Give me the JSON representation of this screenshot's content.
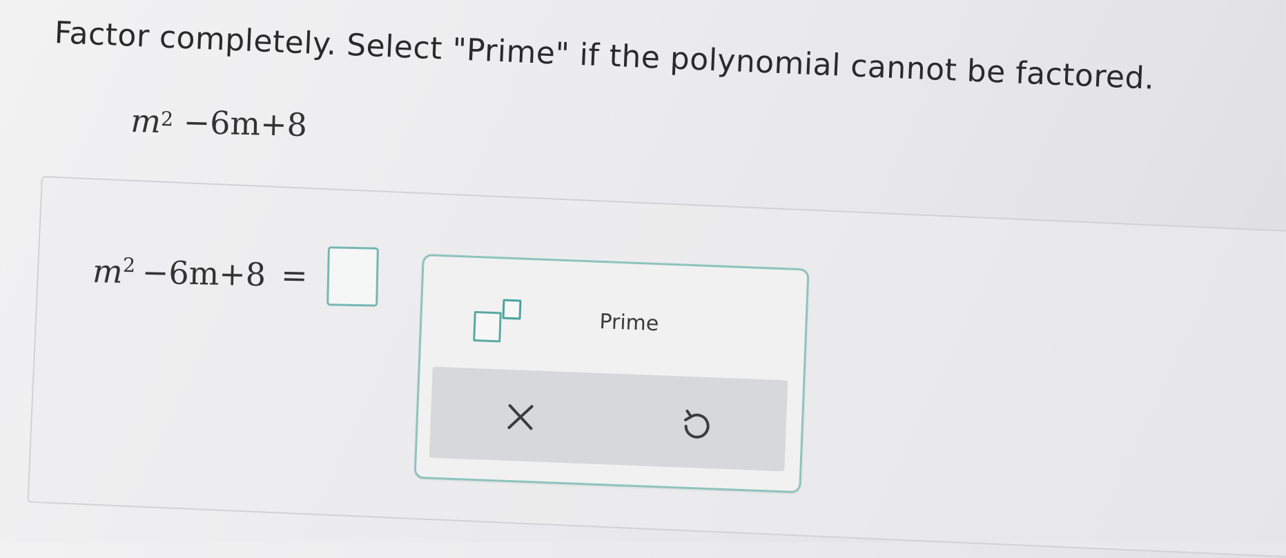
{
  "question": {
    "instruction": "Factor completely. Select \"Prime\" if the polynomial cannot be factored.",
    "expression": {
      "variable": "m",
      "exponent": "2",
      "rest": "−6m+8"
    }
  },
  "answer": {
    "lhs": {
      "variable": "m",
      "exponent": "2",
      "rest": "−6m+8",
      "equals": "="
    }
  },
  "keypad": {
    "prime_label": "Prime",
    "exponent_button": "superscript",
    "clear_icon": "x-icon",
    "undo_icon": "undo-icon"
  },
  "colors": {
    "accent": "#74b7b1",
    "panel_bar": "#d6d8d9",
    "text": "#2b2b2b"
  }
}
